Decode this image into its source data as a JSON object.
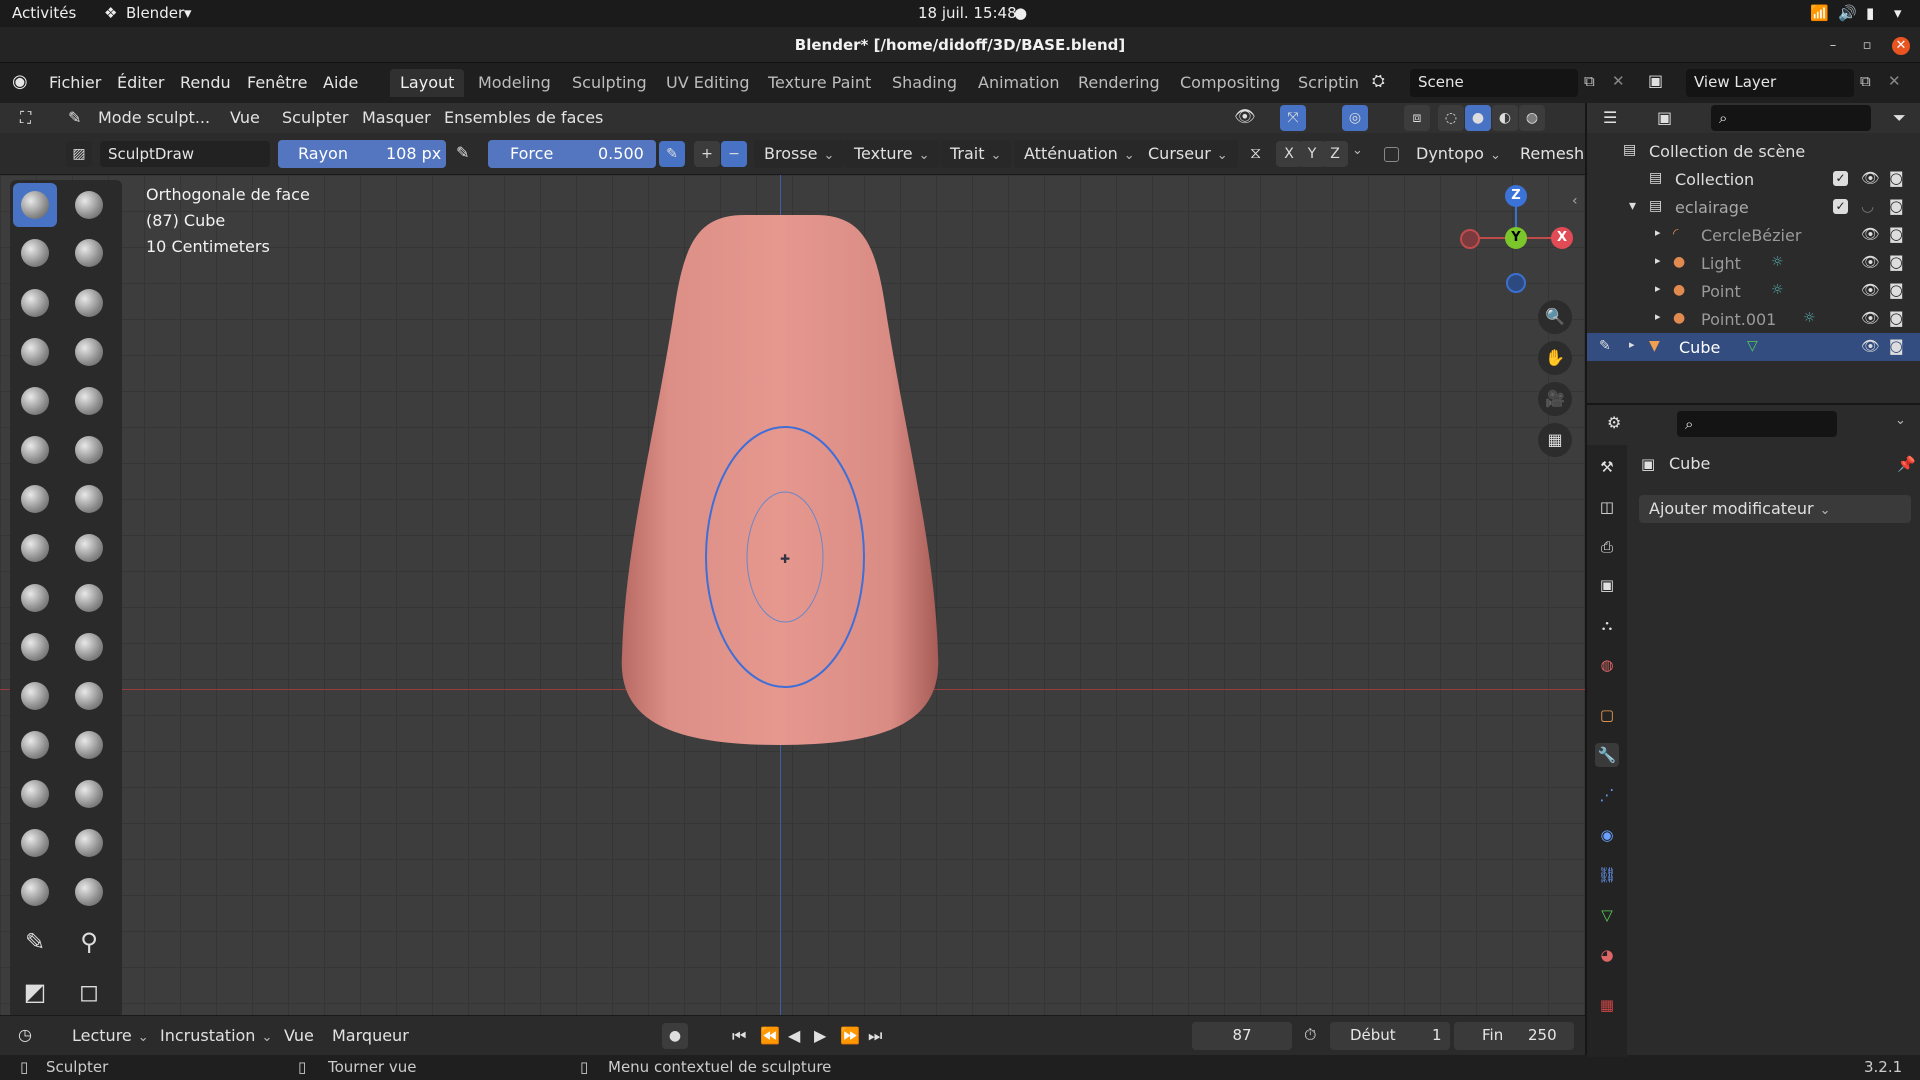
{
  "gnome": {
    "activities": "Activités",
    "app": "Blender",
    "datetime": "18 juil.  15:48"
  },
  "window": {
    "title": "Blender* [/home/didoff/3D/BASE.blend]"
  },
  "menu": {
    "items": [
      "Fichier",
      "Éditer",
      "Rendu",
      "Fenêtre",
      "Aide"
    ]
  },
  "workspaces": [
    "Layout",
    "Modeling",
    "Sculpting",
    "UV Editing",
    "Texture Paint",
    "Shading",
    "Animation",
    "Rendering",
    "Compositing",
    "Scriptinc"
  ],
  "scene": {
    "name": "Scene",
    "view_layer": "View Layer"
  },
  "header1": {
    "mode": "Mode sculpt...",
    "items": [
      "Vue",
      "Sculpter",
      "Masquer",
      "Ensembles de faces"
    ]
  },
  "header2": {
    "brush_name": "SculptDraw",
    "radius_label": "Rayon",
    "radius_value": "108 px",
    "force_label": "Force",
    "force_value": "0.500",
    "dropdowns": [
      "Brosse",
      "Texture",
      "Trait",
      "Atténuation",
      "Curseur"
    ],
    "axes": [
      "X",
      "Y",
      "Z"
    ],
    "dyntopo": "Dyntopo",
    "remesh": "Remesh"
  },
  "viewport": {
    "info": [
      "Orthogonale de face",
      "(87) Cube",
      "10 Centimeters"
    ],
    "gizmo": {
      "z": "Z",
      "y": "Y",
      "x": "X"
    }
  },
  "outliner": {
    "rows": [
      {
        "name": "Collection de scène"
      },
      {
        "name": "Collection"
      },
      {
        "name": "eclairage"
      },
      {
        "name": "CercleBézier"
      },
      {
        "name": "Light"
      },
      {
        "name": "Point"
      },
      {
        "name": "Point.001"
      },
      {
        "name": "Cube"
      }
    ]
  },
  "properties": {
    "object": "Cube",
    "add_modifier": "Ajouter modificateur"
  },
  "timeline": {
    "items": [
      "Lecture",
      "Incrustation",
      "Vue",
      "Marqueur"
    ],
    "frame": "87",
    "start_label": "Début",
    "start": "1",
    "end_label": "Fin",
    "end": "250"
  },
  "status": {
    "left": "Sculpter",
    "mid": "Tourner vue",
    "right": "Menu contextuel de sculpture",
    "version": "3.2.1"
  },
  "colors": {
    "accent": "#4872c4",
    "mesh": "#e0938a",
    "selected_row": "#334d80"
  }
}
